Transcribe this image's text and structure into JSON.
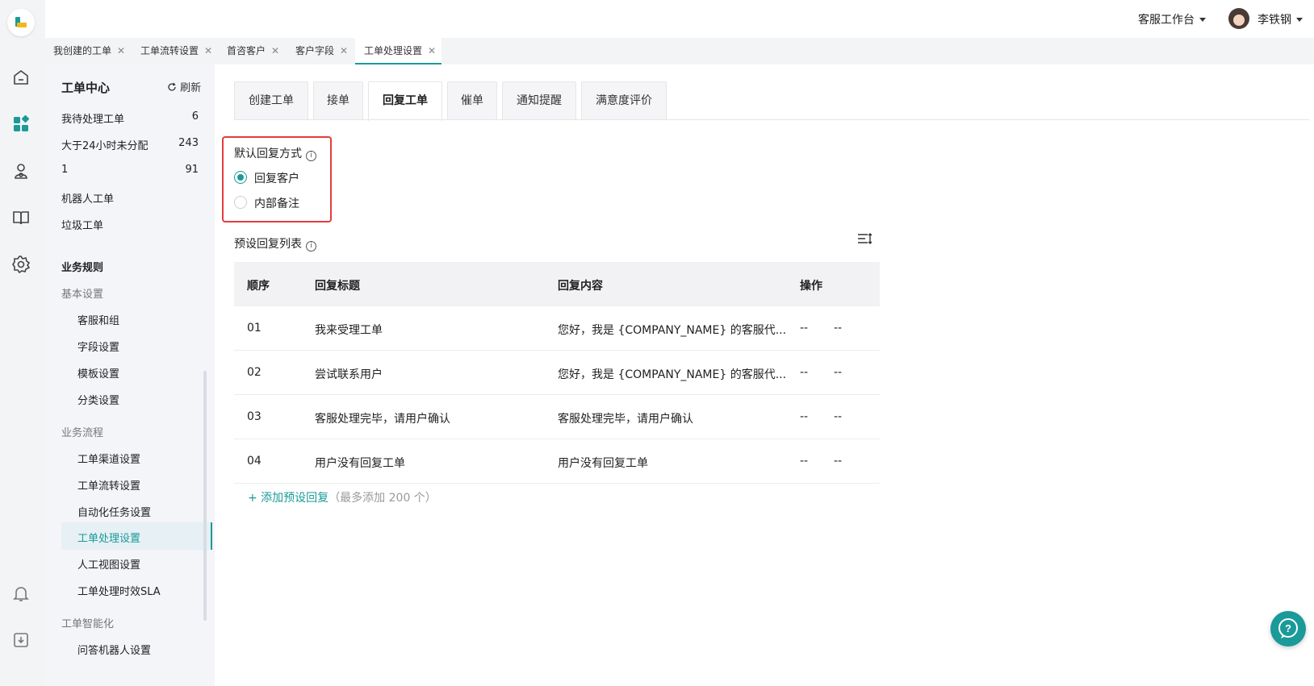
{
  "header": {
    "workspace_label": "客服工作台",
    "user_name": "李铁钢"
  },
  "page_tabs": [
    {
      "label": "我创建的工单",
      "close": "✕"
    },
    {
      "label": "工单流转设置",
      "close": "✕"
    },
    {
      "label": "首咨客户",
      "close": "✕"
    },
    {
      "label": "客户字段",
      "close": "✕"
    },
    {
      "label": "工单处理设置",
      "close": "✕",
      "active": true
    }
  ],
  "sidebar": {
    "title": "工单中心",
    "refresh_label": "刷新",
    "queues": [
      {
        "label": "我待处理工单",
        "count": "6"
      },
      {
        "label": "大于24小时未分配",
        "count": "243"
      },
      {
        "label": "1",
        "count": "91"
      },
      {
        "label": "机器人工单",
        "count": ""
      },
      {
        "label": "垃圾工单",
        "count": ""
      }
    ],
    "rules_section": "业务规则",
    "groups": [
      {
        "label": "基本设置",
        "items": [
          "客服和组",
          "字段设置",
          "模板设置",
          "分类设置"
        ]
      },
      {
        "label": "业务流程",
        "items": [
          "工单渠道设置",
          "工单流转设置",
          "自动化任务设置",
          "工单处理设置",
          "人工视图设置",
          "工单处理时效SLA"
        ]
      },
      {
        "label": "工单智能化",
        "items": [
          "问答机器人设置"
        ]
      }
    ],
    "active_item": "工单处理设置"
  },
  "content_tabs": [
    {
      "label": "创建工单"
    },
    {
      "label": "接单"
    },
    {
      "label": "回复工单",
      "active": true
    },
    {
      "label": "催单"
    },
    {
      "label": "通知提醒"
    },
    {
      "label": "满意度评价"
    }
  ],
  "default_reply": {
    "label": "默认回复方式",
    "options": [
      {
        "label": "回复客户",
        "selected": true
      },
      {
        "label": "内部备注",
        "selected": false
      }
    ]
  },
  "preset_list": {
    "label": "预设回复列表",
    "columns": [
      "顺序",
      "回复标题",
      "回复内容",
      "操作"
    ],
    "rows": [
      {
        "order": "01",
        "title": "我来受理工单",
        "content": "您好，我是 {COMPANY_NAME} 的客服代...",
        "op1": "--",
        "op2": "--"
      },
      {
        "order": "02",
        "title": "尝试联系用户",
        "content": "您好，我是 {COMPANY_NAME} 的客服代...",
        "op1": "--",
        "op2": "--"
      },
      {
        "order": "03",
        "title": "客服处理完毕，请用户确认",
        "content": "客服处理完毕，请用户确认",
        "op1": "--",
        "op2": "--"
      },
      {
        "order": "04",
        "title": "用户没有回复工单",
        "content": "用户没有回复工单",
        "op1": "--",
        "op2": "--"
      }
    ],
    "add_label": "+ 添加预设回复",
    "add_hint": "（最多添加 200 个）"
  },
  "colors": {
    "accent": "#1a9a98",
    "highlight": "#e63b3b",
    "sidebar_bg": "#f3f5f9",
    "rail_bg": "#f3f4f6"
  },
  "icons": {
    "rail": [
      "logo-icon",
      "home-icon",
      "dashboard-icon",
      "customer-icon",
      "book-icon",
      "settings-icon",
      "bell-icon",
      "download-icon"
    ],
    "fab": "chat-icon"
  }
}
